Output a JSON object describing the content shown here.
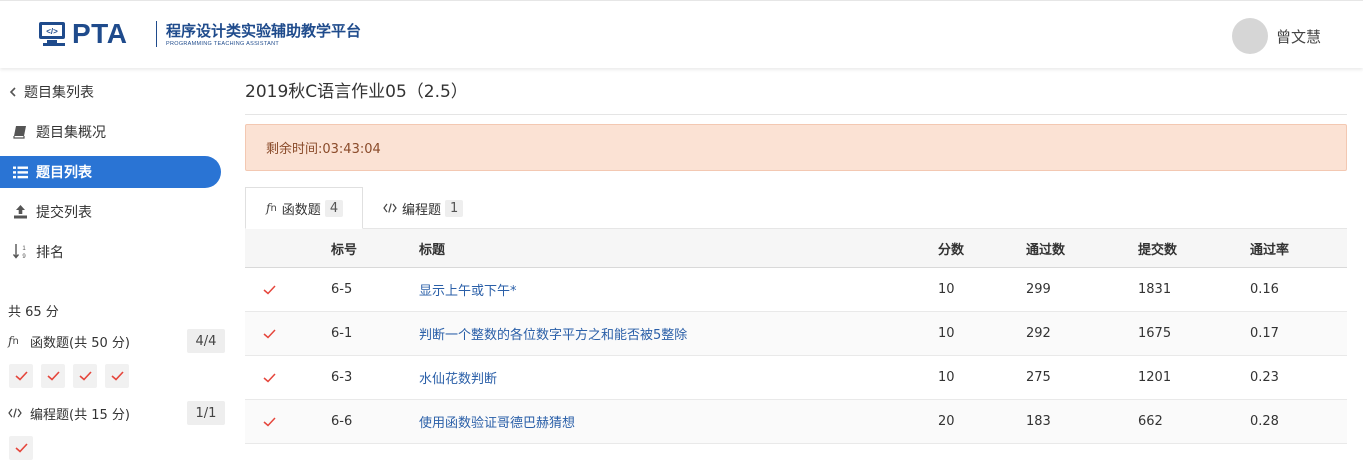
{
  "header": {
    "logo_text": "PTA",
    "platform_name": "程序设计类实验辅助教学平台",
    "platform_name_en": "PROGRAMMING TEACHING ASSISTANT",
    "username": "曾文慧"
  },
  "sidebar": {
    "back_label": "题目集列表",
    "items": [
      {
        "label": "题目集概况",
        "icon": "book-icon",
        "active": false
      },
      {
        "label": "题目列表",
        "icon": "list-icon",
        "active": true
      },
      {
        "label": "提交列表",
        "icon": "upload-icon",
        "active": false
      },
      {
        "label": "排名",
        "icon": "sort-numeric-icon",
        "active": false
      }
    ],
    "score_total": "共 65 分",
    "categories": [
      {
        "label": "函数题(共 50 分)",
        "count": "4/4",
        "icon": "function-icon",
        "checks": 4
      },
      {
        "label": "编程题(共 15 分)",
        "count": "1/1",
        "icon": "code-icon",
        "checks": 1
      }
    ],
    "accent_color": "#2a74d4"
  },
  "main": {
    "title": "2019秋C语言作业05（2.5）",
    "alert": "剩余时间:03:43:04",
    "tabs": [
      {
        "label": "函数题",
        "count": "4",
        "active": true
      },
      {
        "label": "编程题",
        "count": "1",
        "active": false
      }
    ],
    "table": {
      "headers": {
        "status": "",
        "number": "标号",
        "title": "标题",
        "score": "分数",
        "passed": "通过数",
        "submitted": "提交数",
        "rate": "通过率"
      },
      "rows": [
        {
          "status": "✓",
          "number": "6-5",
          "title": "显示上午或下午*",
          "score": "10",
          "passed": "299",
          "submitted": "1831",
          "rate": "0.16"
        },
        {
          "status": "✓",
          "number": "6-1",
          "title": "判断一个整数的各位数字平方之和能否被5整除",
          "score": "10",
          "passed": "292",
          "submitted": "1675",
          "rate": "0.17"
        },
        {
          "status": "✓",
          "number": "6-3",
          "title": "水仙花数判断",
          "score": "10",
          "passed": "275",
          "submitted": "1201",
          "rate": "0.23"
        },
        {
          "status": "✓",
          "number": "6-6",
          "title": "使用函数验证哥德巴赫猜想",
          "score": "20",
          "passed": "183",
          "submitted": "662",
          "rate": "0.28"
        }
      ]
    },
    "alert_color": "#fbe2d4",
    "check_color": "#e5453b"
  }
}
